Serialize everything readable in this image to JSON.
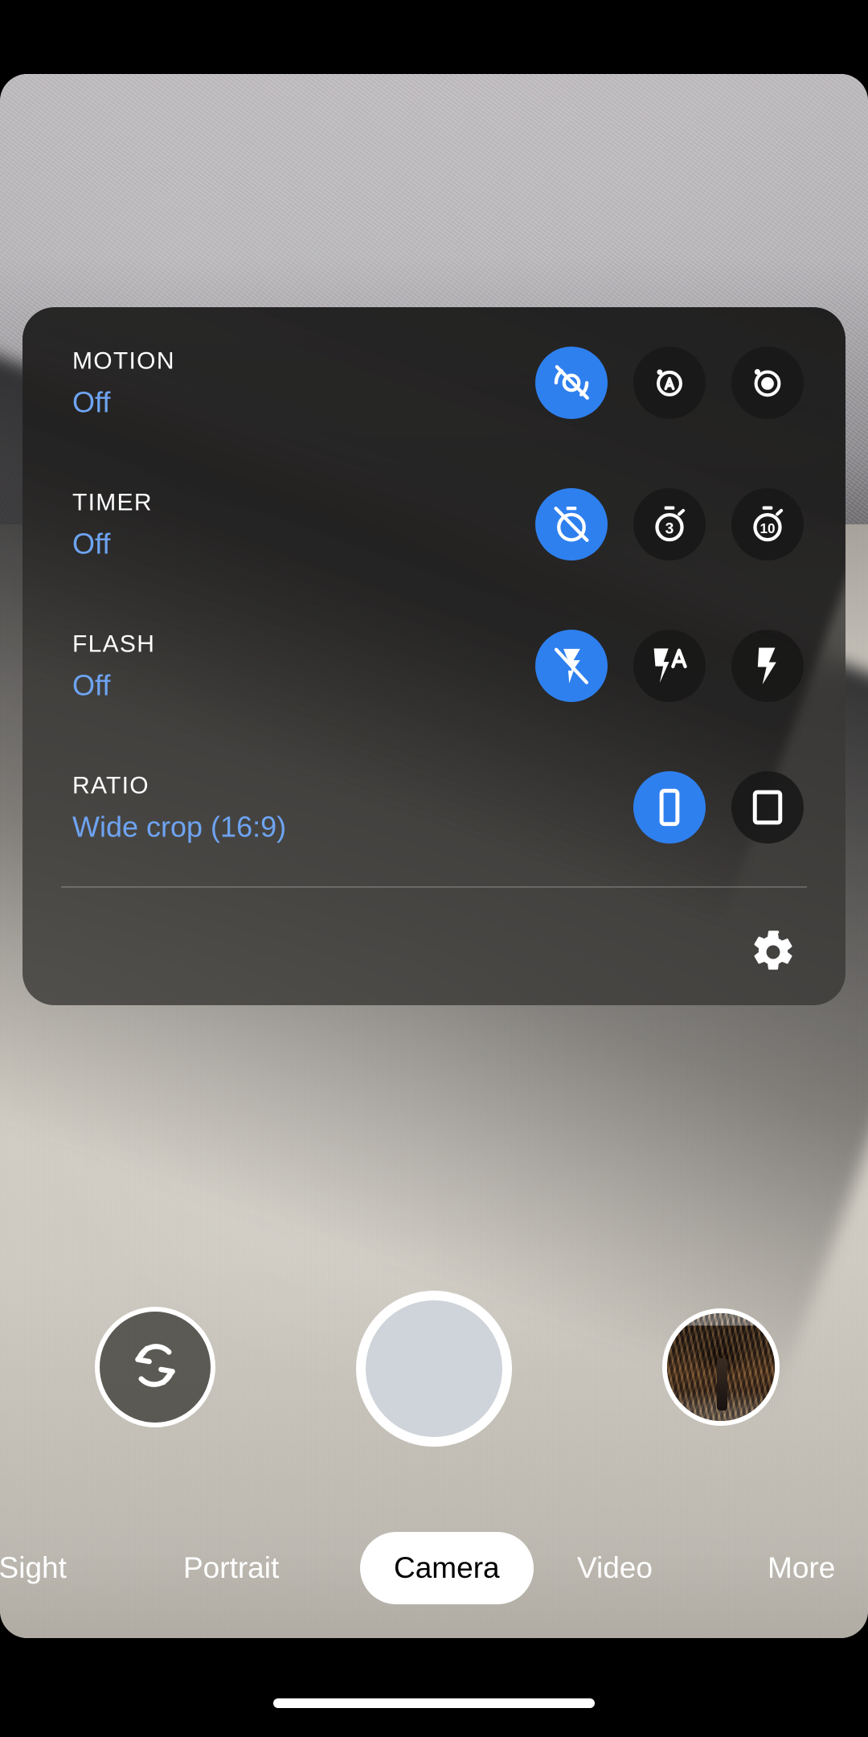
{
  "app": {
    "name": "Camera",
    "accent_blue": "#2f80ef",
    "value_blue": "#6ea4f2",
    "panel_background": "#3a3836"
  },
  "options_panel": {
    "rows": [
      {
        "label": "MOTION",
        "value": "Off",
        "choices": [
          {
            "icon": "motion-off-icon",
            "selected": true
          },
          {
            "icon": "motion-auto-icon",
            "selected": false
          },
          {
            "icon": "motion-on-icon",
            "selected": false
          }
        ]
      },
      {
        "label": "TIMER",
        "value": "Off",
        "choices": [
          {
            "icon": "timer-off-icon",
            "selected": true
          },
          {
            "icon": "timer-3s-icon",
            "label": "3",
            "selected": false
          },
          {
            "icon": "timer-10s-icon",
            "label": "10",
            "selected": false
          }
        ]
      },
      {
        "label": "FLASH",
        "value": "Off",
        "choices": [
          {
            "icon": "flash-off-icon",
            "selected": true
          },
          {
            "icon": "flash-auto-icon",
            "selected": false
          },
          {
            "icon": "flash-on-icon",
            "selected": false
          }
        ]
      },
      {
        "label": "RATIO",
        "value": "Wide crop (16:9)",
        "choices": [
          {
            "icon": "ratio-16-9-icon",
            "selected": true
          },
          {
            "icon": "ratio-4-3-icon",
            "selected": false
          }
        ]
      }
    ],
    "settings_icon": "gear-icon"
  },
  "bottom_controls": {
    "flip_camera_icon": "camera-flip-icon",
    "shutter_icon": "shutter-button",
    "thumbnail_icon": "photo-thumbnail"
  },
  "mode_tabs": {
    "items": [
      {
        "label": "t Sight",
        "selected": false
      },
      {
        "label": "Portrait",
        "selected": false
      },
      {
        "label": "Camera",
        "selected": true
      },
      {
        "label": "Video",
        "selected": false
      },
      {
        "label": "More",
        "selected": false
      }
    ]
  },
  "system": {
    "home_indicator": "home-indicator"
  }
}
